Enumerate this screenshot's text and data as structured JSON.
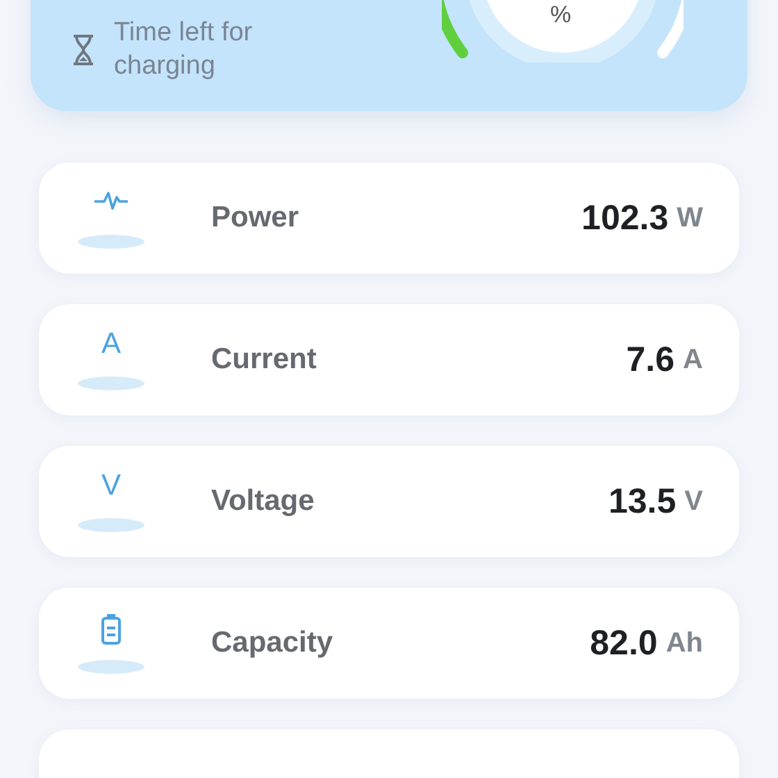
{
  "charging_card": {
    "time_left_label": "Time left for charging",
    "gauge": {
      "unit": "%"
    }
  },
  "metrics": [
    {
      "kind": "pulse",
      "label": "Power",
      "value": "102.3",
      "unit": "W"
    },
    {
      "kind": "letter",
      "icon_char": "A",
      "label": "Current",
      "value": "7.6",
      "unit": "A"
    },
    {
      "kind": "letter",
      "icon_char": "V",
      "label": "Voltage",
      "value": "13.5",
      "unit": "V"
    },
    {
      "kind": "battery",
      "label": "Capacity",
      "value": "82.0",
      "unit": "Ah"
    }
  ]
}
